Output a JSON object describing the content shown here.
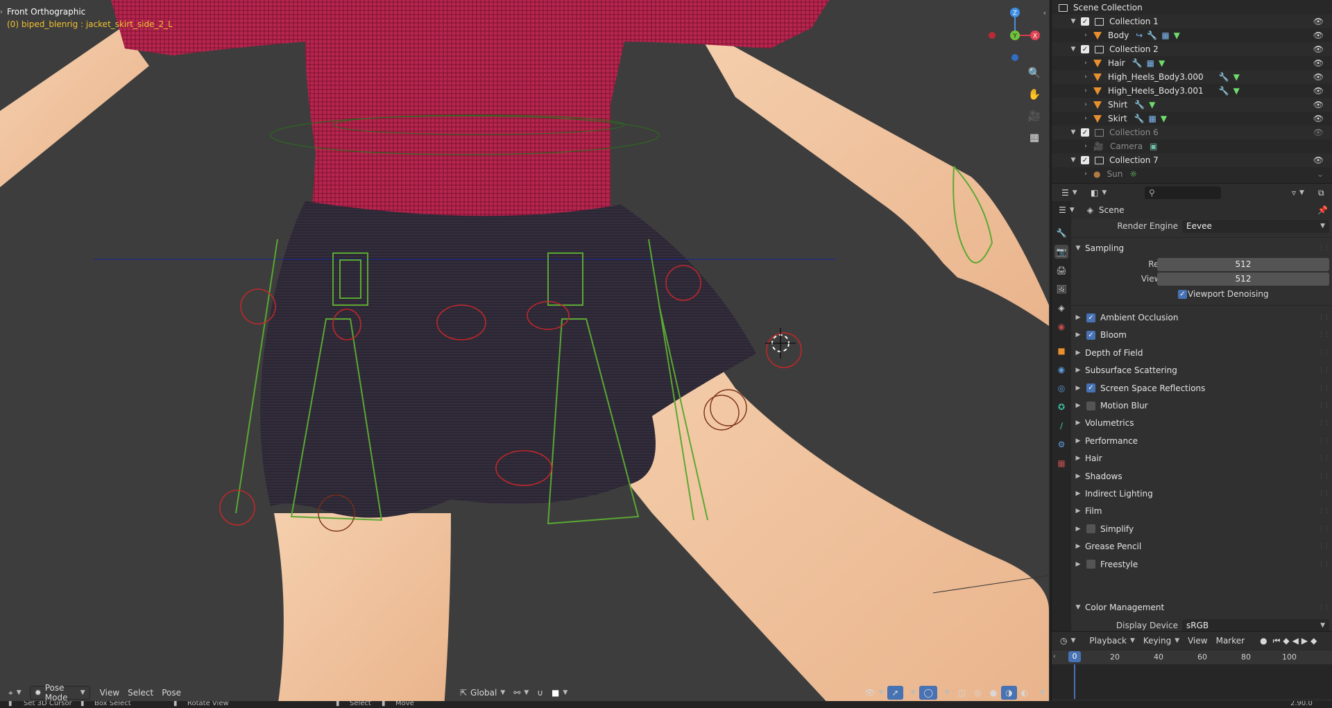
{
  "viewport": {
    "title": "Front Orthographic",
    "subtitle": "(0) biped_blenrig : jacket_skirt_side_2_L",
    "gizmo": {
      "z": "Z",
      "y": "Y",
      "x": "X"
    },
    "tools": [
      "zoom-icon",
      "hand-icon",
      "camera-icon",
      "grid-icon"
    ],
    "header": {
      "mode": "Pose Mode",
      "menus": [
        "View",
        "Select",
        "Pose"
      ],
      "orientation": "Global"
    }
  },
  "statusbar": {
    "items": [
      "Set 3D Cursor",
      "Box Select",
      "Rotate View",
      "Select",
      "Move"
    ],
    "version": "2.90.0"
  },
  "outliner": {
    "root": "Scene Collection",
    "rows": [
      {
        "label": "Collection 1",
        "type": "collection",
        "dim": false
      },
      {
        "label": "Body",
        "type": "object",
        "dim": false
      },
      {
        "label": "Collection 2",
        "type": "collection",
        "dim": false
      },
      {
        "label": "Hair",
        "type": "object",
        "dim": false
      },
      {
        "label": "High_Heels_Body3.000",
        "type": "object",
        "dim": false
      },
      {
        "label": "High_Heels_Body3.001",
        "type": "object",
        "dim": false
      },
      {
        "label": "Shirt",
        "type": "object",
        "dim": false
      },
      {
        "label": "Skirt",
        "type": "object",
        "dim": false
      },
      {
        "label": "Collection 6",
        "type": "collection",
        "dim": true
      },
      {
        "label": "Camera",
        "type": "camera",
        "dim": true
      },
      {
        "label": "Collection 7",
        "type": "collection",
        "dim": false
      },
      {
        "label": "Sun",
        "type": "light",
        "dim": true
      }
    ],
    "search_placeholder": ""
  },
  "properties": {
    "context": "Scene",
    "render_engine_label": "Render Engine",
    "render_engine": "Eevee",
    "sampling": {
      "title": "Sampling",
      "render_label": "Render",
      "render": "512",
      "viewport_label": "Viewport",
      "viewport": "512",
      "denoising_label": "Viewport Denoising"
    },
    "panels": [
      {
        "label": "Ambient Occlusion",
        "check": "on"
      },
      {
        "label": "Bloom",
        "check": "on"
      },
      {
        "label": "Depth of Field",
        "check": "none"
      },
      {
        "label": "Subsurface Scattering",
        "check": "none"
      },
      {
        "label": "Screen Space Reflections",
        "check": "on"
      },
      {
        "label": "Motion Blur",
        "check": "off"
      },
      {
        "label": "Volumetrics",
        "check": "none"
      },
      {
        "label": "Performance",
        "check": "none"
      },
      {
        "label": "Hair",
        "check": "none"
      },
      {
        "label": "Shadows",
        "check": "none"
      },
      {
        "label": "Indirect Lighting",
        "check": "none"
      },
      {
        "label": "Film",
        "check": "none"
      },
      {
        "label": "Simplify",
        "check": "off"
      },
      {
        "label": "Grease Pencil",
        "check": "none"
      },
      {
        "label": "Freestyle",
        "check": "off"
      }
    ],
    "color_management": {
      "title": "Color Management",
      "display_device_label": "Display Device",
      "display_device": "sRGB"
    }
  },
  "timeline": {
    "menus": [
      "Playback",
      "Keying",
      "View",
      "Marker"
    ],
    "current_frame": "0",
    "ticks": [
      "20",
      "40",
      "60",
      "80",
      "100"
    ]
  },
  "colors": {
    "accent": "#4772b3",
    "shirt": "#b8264f",
    "skin": "#f2c6a0",
    "skirt": "#2a2432",
    "bones": "#5aa832",
    "controls": "#c0282a"
  }
}
